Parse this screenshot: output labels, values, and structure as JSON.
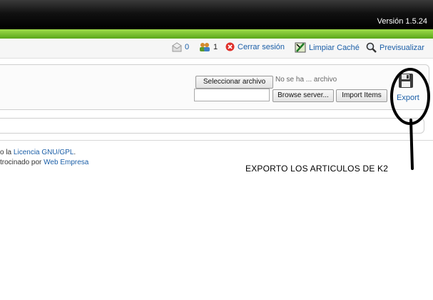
{
  "header": {
    "version": "Versión 1.5.24"
  },
  "statusbar": {
    "messages_count": "0",
    "users_count": "1",
    "logout_label": "Cerrar sesión",
    "cache_label": "Limpiar Caché",
    "preview_label": "Previsualizar",
    "icons": [
      "messages-icon",
      "users-icon",
      "logout-icon",
      "cache-icon",
      "preview-icon"
    ]
  },
  "toolbar": {
    "select_file_label": "Seleccionar archivo",
    "no_file_label": "No se ha ... archivo",
    "browse_server_label": "Browse server...",
    "import_items_label": "Import Items",
    "path_input_value": "",
    "export_label": "Export"
  },
  "footer": {
    "line1_prefix": "o la ",
    "line1_link": "Licencia GNU/GPL",
    "line1_suffix": ".",
    "line2_prefix": "trocinado por ",
    "line2_link": "Web Empresa"
  },
  "note": "EXPORTO LOS ARTICULOS DE K2",
  "colors": {
    "accent_green": "#5aa71a",
    "link_blue": "#1a5ea7"
  }
}
